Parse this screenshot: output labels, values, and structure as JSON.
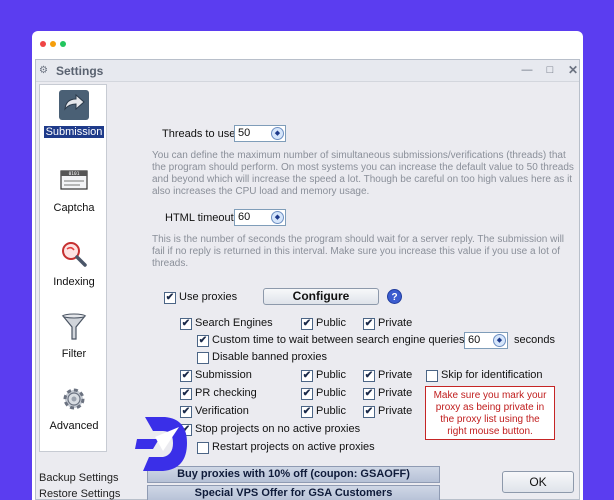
{
  "window": {
    "title": "Settings",
    "minimize": "—",
    "maximize": "□",
    "close": "✕"
  },
  "sidebar": {
    "items": [
      {
        "label": "Submission",
        "icon": "arrow-right-icon",
        "active": true
      },
      {
        "label": "Captcha",
        "icon": "captcha-ticket-icon",
        "active": false
      },
      {
        "label": "Indexing",
        "icon": "magnifier-icon",
        "active": false
      },
      {
        "label": "Filter",
        "icon": "funnel-icon",
        "active": false
      },
      {
        "label": "Advanced",
        "icon": "gear-icon",
        "active": false
      }
    ],
    "backup": "Backup Settings",
    "restore": "Restore Settings"
  },
  "threads": {
    "label": "Threads to use",
    "value": "50",
    "description": "You can define the maximum number of simultaneous submissions/verifications (threads) that the program should perform. On most systems you can increase the default value to 50 threads and beyond which will increase the speed a lot. Though be careful on too high values here as it also increases the CPU load and memory usage."
  },
  "html_timeout": {
    "label": "HTML timeout",
    "value": "60",
    "description": "This is the number of seconds the program should wait for a server reply. The submission will fail if no reply is returned in this interval. Make sure you increase this value if you use a lot of threads."
  },
  "proxies": {
    "use_label": "Use proxies",
    "use_checked": true,
    "configure_label": "Configure",
    "help": "?",
    "search_engines": "Search Engines",
    "custom_wait": "Custom time to wait between search engine queries",
    "custom_wait_value": "60",
    "seconds": "seconds",
    "disable_banned": "Disable banned proxies",
    "submission": "Submission",
    "pr_checking": "PR checking",
    "verification": "Verification",
    "public": "Public",
    "private": "Private",
    "skip_identification": "Skip for identification",
    "stop_projects": "Stop projects on no active proxies",
    "restart_projects": "Restart projects on active proxies",
    "warning": "Make sure you mark your proxy as being private in the proxy list using the right mouse button."
  },
  "promos": {
    "buy_proxies": "Buy proxies with 10% off  (coupon: GSAOFF)",
    "vps_offer": "Special VPS Offer for GSA Customers"
  },
  "ok_label": "OK",
  "check_glyph": "✔",
  "colors": {
    "background": "#5b3df0",
    "dot_red": "#ef4444",
    "dot_yellow": "#f59e0b",
    "dot_green": "#22c55e",
    "warning": "#c01d1d"
  }
}
